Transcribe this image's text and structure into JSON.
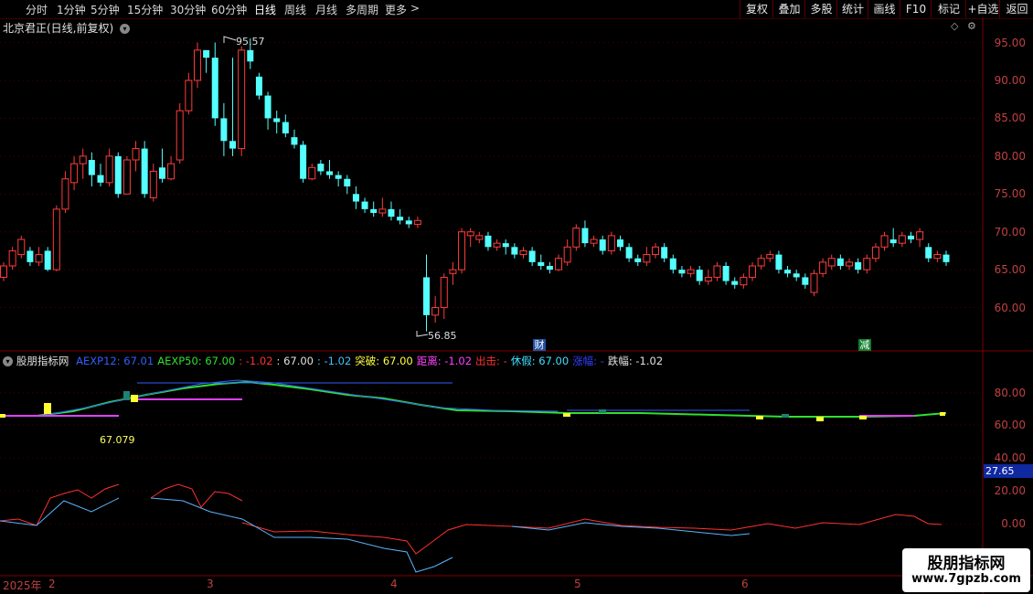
{
  "toolbar": {
    "periods": [
      "分时",
      "1分钟",
      "5分钟",
      "15分钟",
      "30分钟",
      "60分钟",
      "日线",
      "周线",
      "月线",
      "多周期",
      "更多"
    ],
    "active_period": "日线",
    "more_arrow": ">",
    "buttons": [
      "复权",
      "叠加",
      "多股",
      "统计",
      "画线",
      "F10",
      "标记",
      "+自选",
      "返回"
    ]
  },
  "main_chart": {
    "stock_title": "北京君正(日线,前复权)",
    "max_label": "95.57",
    "min_label": "56.85",
    "marker_cai": "财",
    "marker_jian": "减",
    "price_axis": [
      "95.00",
      "90.00",
      "85.00",
      "80.00",
      "75.00",
      "70.00",
      "65.00",
      "60.00"
    ]
  },
  "indicator": {
    "name": "股朋指标网",
    "legend": [
      {
        "text": "AEXP12: 67.01",
        "color": "#3060ff"
      },
      {
        "text": "AEXP50: 67.00",
        "color": "#30e030"
      },
      {
        "text": ": -1.02",
        "color": "#ff3030"
      },
      {
        "text": ": 67.00",
        "color": "#e0e0e0"
      },
      {
        "text": ": -1.02",
        "color": "#40c0ff"
      },
      {
        "text": "突破: 67.00",
        "color": "#ffff40"
      },
      {
        "text": "距离: -1.02",
        "color": "#ff40ff"
      },
      {
        "text": "出击: -",
        "color": "#ff3030"
      },
      {
        "text": "休假: 67.00",
        "color": "#40e0ff"
      },
      {
        "text": "涨幅: -",
        "color": "#3040ff"
      },
      {
        "text": "跌幅: -1.02",
        "color": "#e0e0e0"
      }
    ],
    "value_label": "67.079",
    "axis": [
      "80.00",
      "60.00",
      "40.00",
      "20.00",
      "0.00"
    ],
    "current_value": "27.65"
  },
  "date_axis": [
    {
      "label": "2025年"
    },
    {
      "label": "2"
    },
    {
      "label": "3"
    },
    {
      "label": "4"
    },
    {
      "label": "5"
    },
    {
      "label": "6"
    }
  ],
  "watermark": {
    "line1": "股朋指标网",
    "line2": "www.7gpzb.com"
  },
  "chart_data": {
    "type": "candlestick",
    "ylim": [
      55,
      97
    ],
    "candles": [
      [
        64.0,
        65.5,
        63.5,
        66.0
      ],
      [
        65.5,
        67.5,
        65.0,
        68.0
      ],
      [
        67.0,
        69.0,
        66.5,
        69.5
      ],
      [
        67.5,
        66.0,
        65.5,
        68.0
      ],
      [
        66.0,
        67.0,
        65.5,
        68.0
      ],
      [
        67.5,
        65.0,
        64.8,
        68.0
      ],
      [
        65.0,
        73.0,
        64.8,
        73.5
      ],
      [
        73.0,
        77.0,
        72.5,
        78.0
      ],
      [
        76.5,
        79.0,
        75.5,
        80.0
      ],
      [
        79.0,
        80.0,
        77.0,
        81.0
      ],
      [
        79.5,
        77.5,
        76.0,
        80.5
      ],
      [
        77.5,
        76.5,
        76.0,
        79.0
      ],
      [
        76.5,
        80.0,
        76.0,
        81.0
      ],
      [
        80.0,
        75.0,
        74.5,
        80.5
      ],
      [
        75.0,
        79.5,
        75.0,
        80.0
      ],
      [
        79.5,
        81.0,
        78.0,
        82.0
      ],
      [
        81.0,
        75.0,
        74.5,
        82.0
      ],
      [
        74.5,
        78.0,
        74.0,
        79.0
      ],
      [
        78.5,
        77.0,
        76.5,
        81.0
      ],
      [
        77.0,
        79.0,
        76.8,
        80.0
      ],
      [
        79.5,
        86.0,
        79.0,
        87.0
      ],
      [
        86.0,
        90.0,
        85.5,
        91.0
      ],
      [
        90.0,
        94.0,
        89.0,
        95.0
      ],
      [
        94.0,
        93.0,
        91.0,
        94.0
      ],
      [
        93.0,
        85.0,
        84.0,
        95.0
      ],
      [
        85.0,
        82.0,
        80.0,
        87.0
      ],
      [
        82.0,
        81.0,
        80.0,
        93.0
      ],
      [
        81.0,
        94.0,
        80.0,
        94.5
      ],
      [
        94.0,
        92.5,
        91.5,
        95.57
      ],
      [
        90.5,
        88.0,
        87.5,
        91.0
      ],
      [
        88.0,
        85.0,
        83.5,
        88.5
      ],
      [
        85.0,
        84.5,
        83.0,
        86.0
      ],
      [
        84.5,
        83.0,
        82.5,
        85.5
      ],
      [
        82.5,
        81.5,
        81.0,
        83.5
      ],
      [
        81.5,
        77.0,
        76.5,
        82.0
      ],
      [
        77.0,
        78.5,
        76.8,
        79.0
      ],
      [
        79.0,
        78.0,
        77.5,
        79.5
      ],
      [
        78.0,
        77.5,
        77.0,
        79.5
      ],
      [
        77.5,
        77.0,
        76.0,
        78.0
      ],
      [
        77.0,
        76.0,
        75.0,
        77.5
      ],
      [
        75.0,
        74.0,
        73.0,
        76.0
      ],
      [
        74.0,
        73.0,
        72.5,
        74.5
      ],
      [
        73.0,
        72.5,
        72.0,
        74.0
      ],
      [
        72.5,
        73.0,
        72.0,
        74.5
      ],
      [
        73.0,
        72.0,
        71.5,
        74.0
      ],
      [
        72.0,
        71.5,
        71.0,
        73.0
      ],
      [
        71.5,
        71.0,
        70.5,
        72.0
      ],
      [
        71.0,
        71.5,
        70.5,
        72.0
      ],
      [
        64.0,
        59.0,
        56.85,
        67.0
      ],
      [
        59.0,
        60.0,
        58.0,
        61.5
      ],
      [
        60.0,
        64.0,
        58.5,
        64.5
      ],
      [
        64.5,
        65.0,
        63.0,
        66.0
      ],
      [
        65.0,
        70.0,
        64.5,
        70.5
      ],
      [
        69.5,
        70.0,
        68.0,
        70.5
      ],
      [
        69.0,
        69.5,
        68.5,
        70.0
      ],
      [
        69.5,
        68.0,
        67.5,
        70.0
      ],
      [
        68.0,
        68.5,
        67.5,
        69.0
      ],
      [
        68.5,
        68.0,
        67.0,
        69.0
      ],
      [
        68.0,
        67.0,
        66.5,
        68.5
      ],
      [
        67.0,
        67.5,
        66.5,
        68.0
      ],
      [
        67.5,
        66.0,
        65.5,
        68.0
      ],
      [
        66.0,
        65.5,
        65.0,
        67.0
      ],
      [
        65.5,
        65.0,
        64.5,
        66.0
      ],
      [
        65.0,
        66.5,
        64.8,
        67.0
      ],
      [
        66.0,
        68.0,
        65.5,
        69.0
      ],
      [
        68.0,
        70.5,
        67.5,
        71.0
      ],
      [
        70.5,
        68.5,
        68.0,
        71.5
      ],
      [
        68.5,
        69.0,
        68.0,
        69.5
      ],
      [
        69.0,
        67.5,
        67.0,
        69.5
      ],
      [
        67.5,
        69.5,
        67.0,
        70.0
      ],
      [
        69.0,
        68.0,
        67.5,
        69.5
      ],
      [
        68.0,
        66.5,
        66.0,
        68.5
      ],
      [
        66.5,
        66.0,
        65.5,
        67.0
      ],
      [
        66.0,
        67.0,
        65.5,
        68.0
      ],
      [
        67.0,
        68.0,
        66.5,
        68.5
      ],
      [
        68.0,
        66.5,
        66.0,
        68.5
      ],
      [
        66.5,
        65.0,
        64.5,
        67.0
      ],
      [
        65.0,
        64.5,
        64.0,
        65.5
      ],
      [
        64.5,
        65.0,
        64.0,
        65.5
      ],
      [
        65.0,
        63.5,
        63.0,
        65.5
      ],
      [
        63.5,
        64.0,
        63.0,
        65.0
      ],
      [
        64.0,
        65.5,
        63.5,
        66.0
      ],
      [
        65.5,
        63.5,
        63.0,
        66.0
      ],
      [
        63.5,
        63.0,
        62.5,
        64.0
      ],
      [
        63.0,
        64.0,
        62.5,
        64.5
      ],
      [
        64.0,
        65.5,
        63.5,
        66.0
      ],
      [
        65.5,
        66.5,
        65.0,
        67.0
      ],
      [
        66.5,
        67.0,
        66.0,
        67.5
      ],
      [
        67.0,
        65.0,
        64.5,
        67.5
      ],
      [
        65.0,
        64.5,
        64.0,
        65.5
      ],
      [
        64.5,
        64.0,
        63.5,
        65.0
      ],
      [
        64.0,
        63.0,
        62.5,
        64.5
      ],
      [
        62.0,
        64.5,
        61.5,
        65.0
      ],
      [
        64.5,
        66.0,
        64.0,
        66.5
      ],
      [
        65.5,
        66.5,
        65.0,
        67.0
      ],
      [
        66.5,
        65.5,
        65.0,
        67.0
      ],
      [
        65.5,
        66.0,
        65.0,
        66.5
      ],
      [
        66.0,
        65.0,
        64.5,
        66.5
      ],
      [
        65.0,
        66.5,
        64.5,
        67.0
      ],
      [
        66.5,
        68.0,
        66.0,
        68.5
      ],
      [
        68.0,
        69.5,
        67.5,
        70.0
      ],
      [
        69.0,
        68.5,
        68.0,
        70.5
      ],
      [
        68.5,
        69.5,
        68.0,
        70.0
      ],
      [
        69.5,
        69.0,
        68.5,
        70.0
      ],
      [
        69.0,
        70.0,
        68.0,
        70.5
      ],
      [
        68.0,
        66.5,
        66.0,
        68.5
      ],
      [
        66.5,
        67.0,
        66.0,
        67.5
      ],
      [
        67.0,
        66.0,
        65.5,
        67.5
      ]
    ]
  }
}
